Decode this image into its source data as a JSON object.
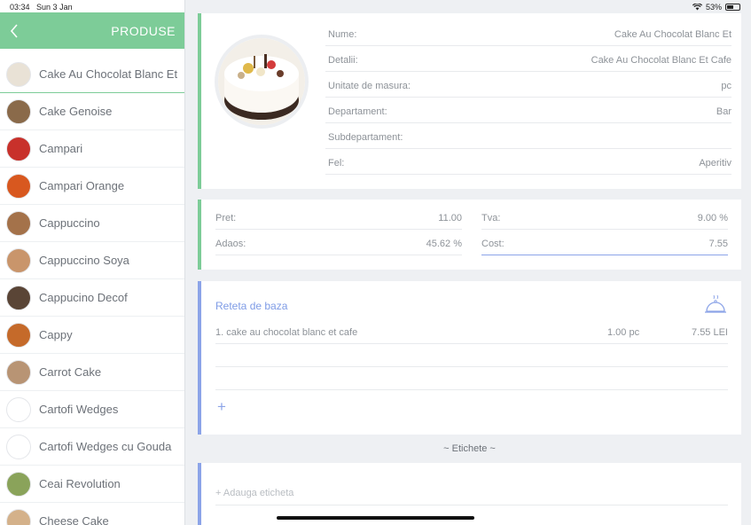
{
  "status": {
    "time": "03:34",
    "date": "Sun 3 Jan",
    "battery": "53%"
  },
  "sidebar": {
    "title": "PRODUSE",
    "items": [
      {
        "label": "Cake Au Chocolat Blanc Et",
        "color": "#e9e2d6",
        "selected": true
      },
      {
        "label": "Cake Genoise",
        "color": "#8a6a4a"
      },
      {
        "label": "Campari",
        "color": "#c8312b"
      },
      {
        "label": "Campari Orange",
        "color": "#d8581f"
      },
      {
        "label": "Cappuccino",
        "color": "#a4724a"
      },
      {
        "label": "Cappuccino Soya",
        "color": "#c9956b"
      },
      {
        "label": "Cappucino Decof",
        "color": "#5a4536"
      },
      {
        "label": "Cappy",
        "color": "#c56a2a"
      },
      {
        "label": "Carrot Cake",
        "color": "#b89474"
      },
      {
        "label": "Cartofi Wedges",
        "color": "#ffffff"
      },
      {
        "label": "Cartofi Wedges cu Gouda",
        "color": "#ffffff"
      },
      {
        "label": "Ceai Revolution",
        "color": "#8aa35a"
      },
      {
        "label": "Cheese Cake",
        "color": "#d4b18a"
      }
    ]
  },
  "product": {
    "fields": [
      {
        "label": "Nume:",
        "value": "Cake Au Chocolat Blanc Et"
      },
      {
        "label": "Detalii:",
        "value": "Cake Au Chocolat Blanc Et Cafe"
      },
      {
        "label": "Unitate de masura:",
        "value": "pc"
      },
      {
        "label": "Departament:",
        "value": "Bar"
      },
      {
        "label": "Subdepartament:",
        "value": ""
      },
      {
        "label": "Fel:",
        "value": "Aperitiv"
      }
    ]
  },
  "pricing": {
    "pret_label": "Pret:",
    "pret_value": "11.00",
    "tva_label": "Tva:",
    "tva_value": "9.00 %",
    "adaos_label": "Adaos:",
    "adaos_value": "45.62 %",
    "cost_label": "Cost:",
    "cost_value": "7.55"
  },
  "recipe": {
    "title": "Reteta de baza",
    "rows": [
      {
        "name": "1. cake au chocolat blanc et cafe",
        "qty": "1.00  pc",
        "price": "7.55 LEI"
      }
    ],
    "add_symbol": "+"
  },
  "tags": {
    "title": "~ Etichete ~",
    "placeholder": "+ Adauga eticheta"
  },
  "colors": {
    "accent_green": "#7dcc98",
    "accent_blue": "#8ca4e8"
  }
}
